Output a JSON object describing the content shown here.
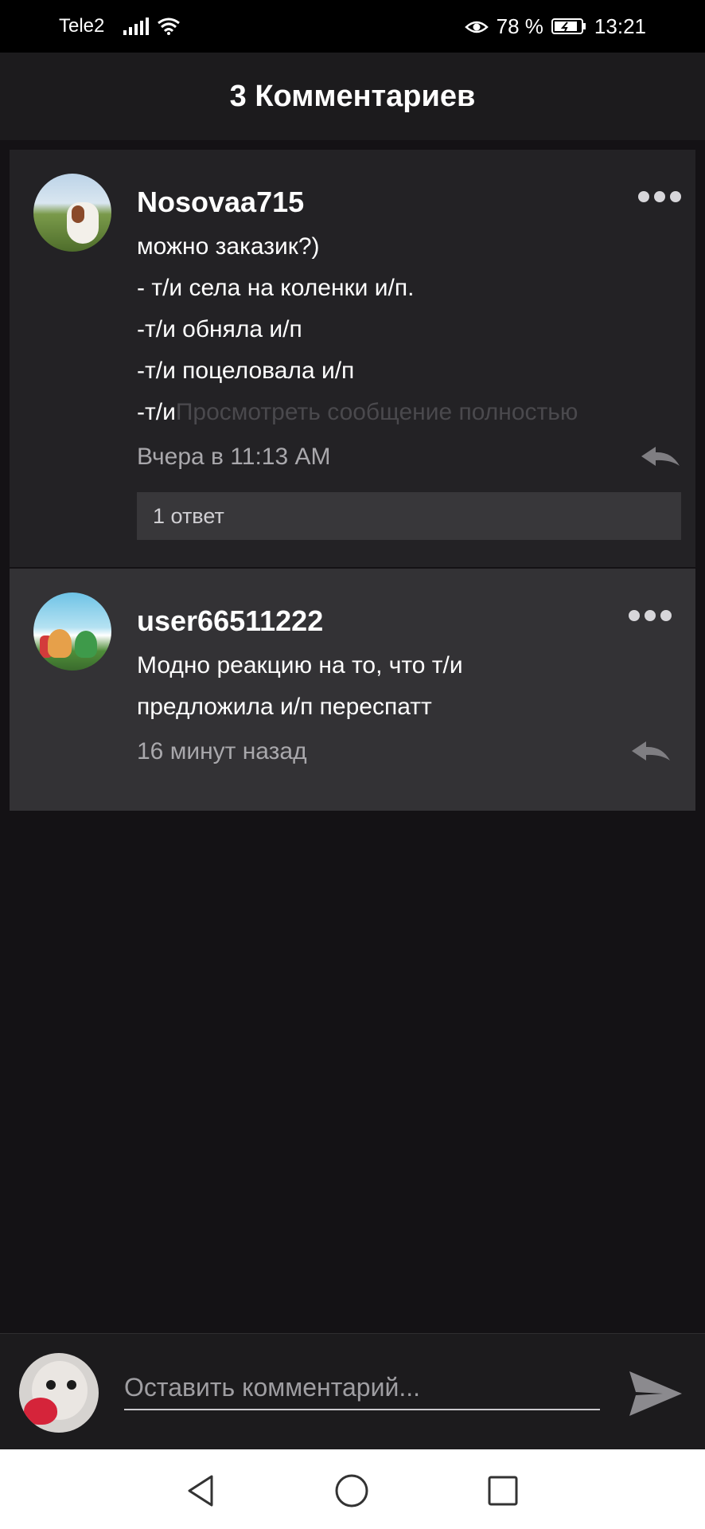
{
  "status_bar": {
    "carrier": "Tele2",
    "battery_percent": "78 %",
    "time": "13:21"
  },
  "header": {
    "title": "3 Комментариев"
  },
  "comments": [
    {
      "username": "Nosovaa715",
      "lines": [
        "можно заказик?)",
        "- т/и села на коленки и/п.",
        "-т/и обняла и/п",
        "-т/и поцеловала и/п",
        "-т/и"
      ],
      "view_full": "Просмотреть сообщение полностью",
      "timestamp": "Вчера в 11:13 AM",
      "replies": "1 ответ"
    },
    {
      "username": "user66511222",
      "lines": [
        "Модно реакцию на то, что т/и",
        "предложила и/п переспатт"
      ],
      "timestamp": "16 минут назад"
    }
  ],
  "composer": {
    "placeholder": "Оставить комментарий..."
  },
  "colors": {
    "background": "#141215",
    "header": "#1c1b1d",
    "comment_1_bg": "#232225",
    "comment_2_bg": "#333235",
    "muted_text": "#a9a8ac"
  },
  "icons": {
    "more": "more-horizontal-icon",
    "reply": "reply-arrow-icon",
    "send": "send-icon",
    "nav": [
      "back-triangle-icon",
      "home-circle-icon",
      "recents-square-icon"
    ]
  }
}
